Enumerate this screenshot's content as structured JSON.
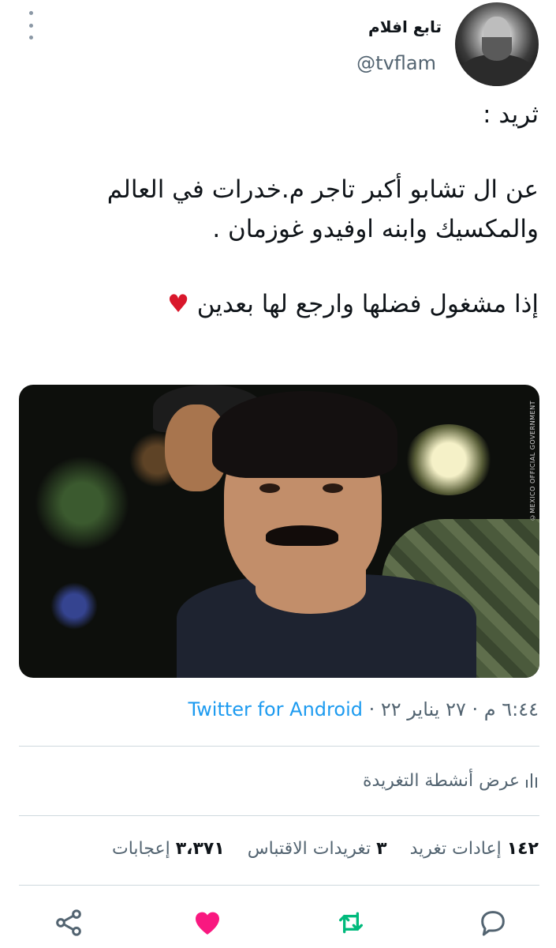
{
  "author": {
    "display_name": "تابع افلام",
    "handle": "@tvflam"
  },
  "tweet": {
    "lines": [
      "ثريد :",
      "",
      "عن ال تشابو أكبر تاجر م.خدرات في العالم",
      "والمكسيك وابنه اوفيدو غوزمان .",
      "",
      "إذا مشغول فضلها وارجع لها بعدين"
    ],
    "emoji": "♥"
  },
  "image": {
    "watermark": "©MEXICO OFFICIAL GOVERNMENT"
  },
  "meta": {
    "time": "٦:٤٤ م",
    "separator1": " · ",
    "date": "٢٧ يناير ٢٢",
    "separator2": " · ",
    "source": "Twitter for Android"
  },
  "activity": {
    "label": "عرض أنشطة التغريدة",
    "icon": "analytics-bars-icon"
  },
  "stats": {
    "retweets_count": "١٤٢",
    "retweets_label": "إعادات تغريد",
    "quotes_count": "٣",
    "quotes_label": "تغريدات الاقتباس",
    "likes_count": "٣،٣٧١",
    "likes_label": "إعجابات"
  },
  "actions": {
    "reply_icon": "reply-icon",
    "retweet_icon": "retweet-icon",
    "like_icon": "like-icon",
    "share_icon": "share-icon"
  },
  "colors": {
    "text": "#0f1419",
    "muted": "#536471",
    "link": "#1d9bf0",
    "like": "#f91880",
    "retweet": "#00ba7c",
    "heart_emoji": "#d9172b"
  }
}
